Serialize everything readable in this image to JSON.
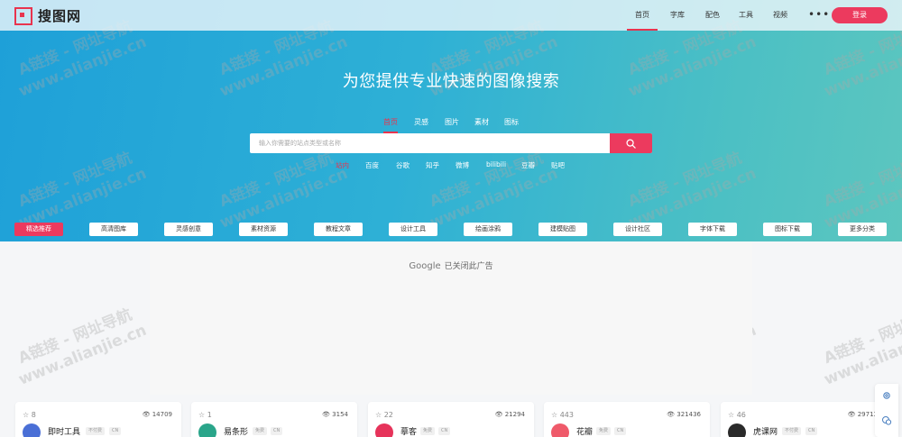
{
  "brand": {
    "name": "搜图网",
    "accent": "#ec3a5e"
  },
  "nav": {
    "items": [
      {
        "label": "首页",
        "active": true
      },
      {
        "label": "字库",
        "active": false
      },
      {
        "label": "配色",
        "active": false
      },
      {
        "label": "工具",
        "active": false
      },
      {
        "label": "视频",
        "active": false
      }
    ],
    "more": "•••",
    "login": "登录"
  },
  "hero": {
    "headline": "为您提供专业快速的图像搜索",
    "search_tabs": [
      "首页",
      "灵感",
      "图片",
      "素材",
      "图标"
    ],
    "search_placeholder": "输入你需要的站点类型或名称",
    "engines": [
      "站内",
      "百度",
      "谷歌",
      "知乎",
      "微博",
      "bilibili",
      "豆瓣",
      "贴吧"
    ]
  },
  "categories": [
    "精选推荐",
    "高清图库",
    "灵感创意",
    "素材资源",
    "教程文章",
    "设计工具",
    "绘画涂鸦",
    "建模贴图",
    "设计社区",
    "字体下载",
    "图标下载",
    "更多分类"
  ],
  "ad": {
    "google": "Google",
    "text": "已关闭此广告"
  },
  "cards": [
    {
      "stars": "8",
      "views": "14709",
      "name": "即时工具",
      "tags": [
        "不付费",
        "CN"
      ],
      "avatar_color": "#4a6fd6"
    },
    {
      "stars": "1",
      "views": "3154",
      "name": "易条形",
      "tags": [
        "免费",
        "CN"
      ],
      "avatar_color": "#2aa58a"
    },
    {
      "stars": "22",
      "views": "21294",
      "name": "摹客",
      "tags": [
        "免费",
        "CN"
      ],
      "avatar_color": "#e6335a"
    },
    {
      "stars": "443",
      "views": "321436",
      "name": "花瓣",
      "tags": [
        "免费",
        "CN"
      ],
      "avatar_color": "#ef5a6a"
    },
    {
      "stars": "46",
      "views": "29713",
      "name": "虎课网",
      "tags": [
        "不付费",
        "CN"
      ],
      "avatar_color": "#2a2a2a"
    }
  ],
  "watermark": {
    "line1": "A链接 - 网址导航",
    "line2": "www.alianjie.cn"
  }
}
